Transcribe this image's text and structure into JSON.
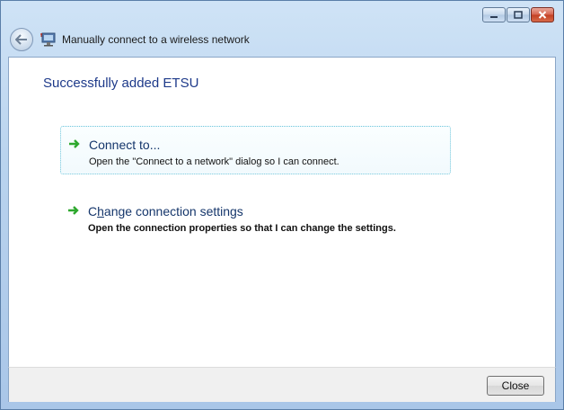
{
  "window": {
    "title": "Manually connect to a wireless network",
    "caption_icons": [
      "minimize-icon",
      "maximize-icon",
      "close-icon"
    ]
  },
  "page": {
    "heading": "Successfully added ETSU"
  },
  "options": [
    {
      "title": "Connect to...",
      "description": "Open the \"Connect to a network\" dialog so I can connect.",
      "icon": "green-arrow-icon",
      "selected": true
    },
    {
      "title_pre": "C",
      "title_access": "h",
      "title_post": "ange connection settings",
      "description": "Open the connection properties so that I can change the settings.",
      "icon": "green-arrow-icon",
      "selected": false
    }
  ],
  "footer": {
    "close_label": "Close"
  },
  "colors": {
    "heading": "#1e3a8a",
    "link_title": "#15366b",
    "arrow": "#2ea82e",
    "selected_border": "#6fc6dc"
  }
}
